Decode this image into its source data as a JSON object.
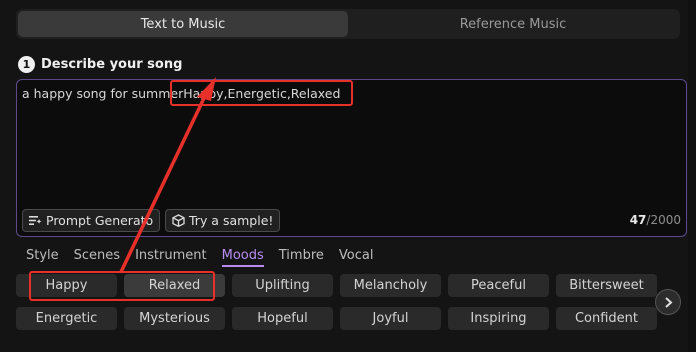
{
  "mode_tabs": [
    "Text to Music",
    "Reference Music"
  ],
  "step": {
    "number": "1",
    "title": "Describe your song"
  },
  "prompt": {
    "text": "a happy song for summerHappy,Energetic,Relaxed"
  },
  "buttons": {
    "prompt_generator": "Prompt Generato",
    "try_sample": "Try a sample!"
  },
  "counter": {
    "current": "47",
    "max": "/2000"
  },
  "category_tabs": [
    "Style",
    "Scenes",
    "Instrument",
    "Moods",
    "Timbre",
    "Vocal"
  ],
  "active_category": "Moods",
  "tags_row1": [
    "Happy",
    "Relaxed",
    "Uplifting",
    "Melancholy",
    "Peaceful",
    "Bittersweet"
  ],
  "tags_row2": [
    "Energetic",
    "Mysterious",
    "Hopeful",
    "Joyful",
    "Inspiring",
    "Confident"
  ],
  "colors": {
    "accent": "#b98cf0",
    "highlight": "#e8302a",
    "border": "#5d4a8a"
  },
  "icons": [
    "prompt-generator-icon",
    "sample-cube-icon",
    "chevron-right-icon"
  ]
}
